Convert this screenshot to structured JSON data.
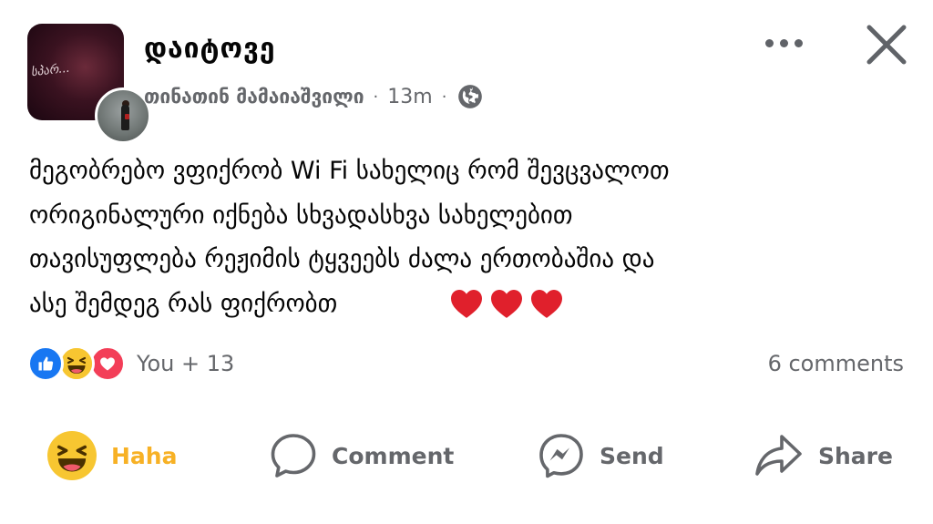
{
  "post": {
    "group_name": "დაიტოვე",
    "group_avatar_text": "სპარ...",
    "author": "თინათინ მამაიაშვილი",
    "time": "13m",
    "separator": "·",
    "privacy_icon": "globe-icon",
    "text": "მეგობრებო ვფიქრობ Wi Fi სახელიც რომ შევცვალოთ\nორიგინალური იქნება სხვადასხვა სახელებით\nთავისუფლება რეჟიმის ტყვეებს ძალა ერთობაშია და\nასე შემდეგ რას ფიქრობთ",
    "emoji": [
      "heart",
      "heart",
      "heart"
    ]
  },
  "header": {
    "more_icon": "more-horizontal-icon",
    "close_icon": "close-icon"
  },
  "reactions": {
    "types": [
      "like",
      "haha",
      "love"
    ],
    "summary": "You + 13",
    "comments": "6 comments"
  },
  "actions": {
    "haha": "Haha",
    "comment": "Comment",
    "send": "Send",
    "share": "Share"
  },
  "colors": {
    "like": "#1877f2",
    "haha": "#f7c631",
    "love": "#f33e58",
    "heart": "#e0202c",
    "muted": "#65676b"
  }
}
